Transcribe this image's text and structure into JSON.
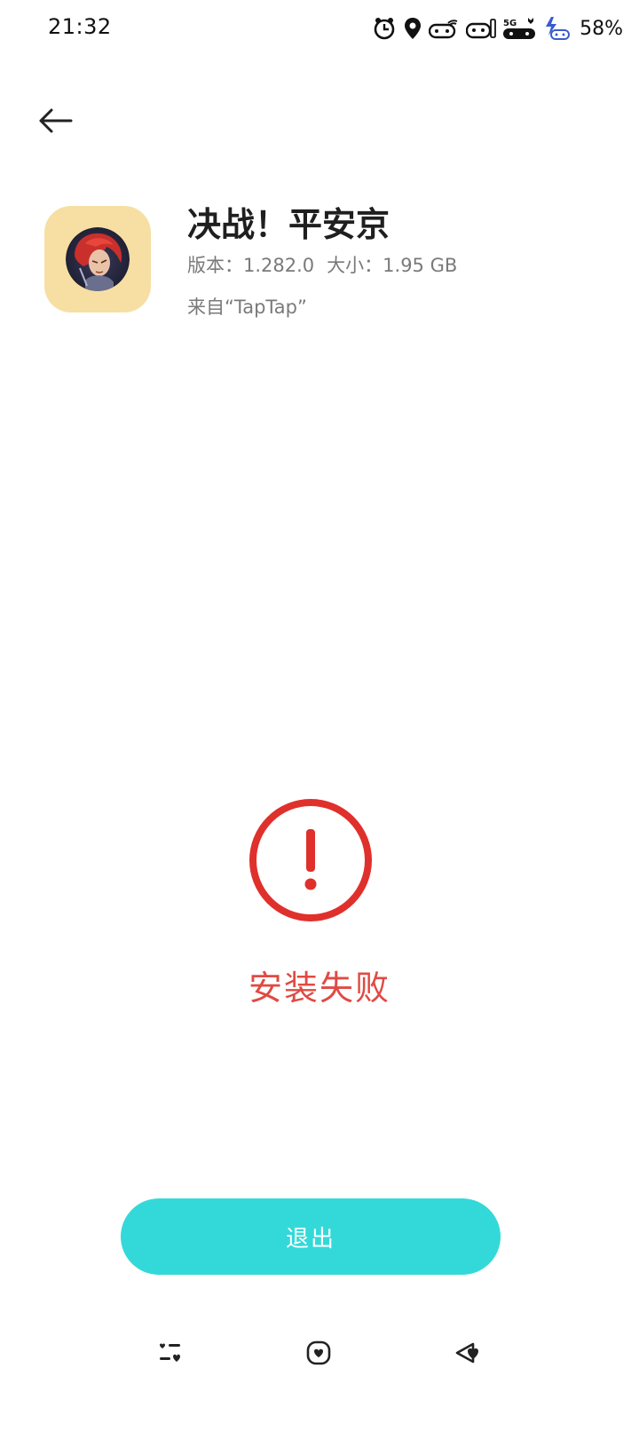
{
  "status_bar": {
    "time": "21:32",
    "battery": "58%",
    "icons": [
      "alarm-icon",
      "location-icon",
      "game-controller-icon",
      "wifi-icon",
      "cat-face-icon",
      "signal-5g-icon",
      "lightning-icon"
    ]
  },
  "header": {
    "back_icon": "arrow-left-icon"
  },
  "app": {
    "name": "决战！平安京",
    "version_label": "版本：",
    "version": "1.282.0",
    "size_label": "大小：",
    "size": "1.95 GB",
    "source": "来自“TapTap”"
  },
  "result": {
    "icon": "exclamation-circle-icon",
    "message": "安装失败",
    "color": "#e04a43"
  },
  "actions": {
    "exit_label": "退出",
    "exit_color": "#33d9d9"
  },
  "bottom_nav": {
    "icons": [
      "list-heart-icon",
      "heart-square-icon",
      "heart-arrow-icon"
    ]
  }
}
